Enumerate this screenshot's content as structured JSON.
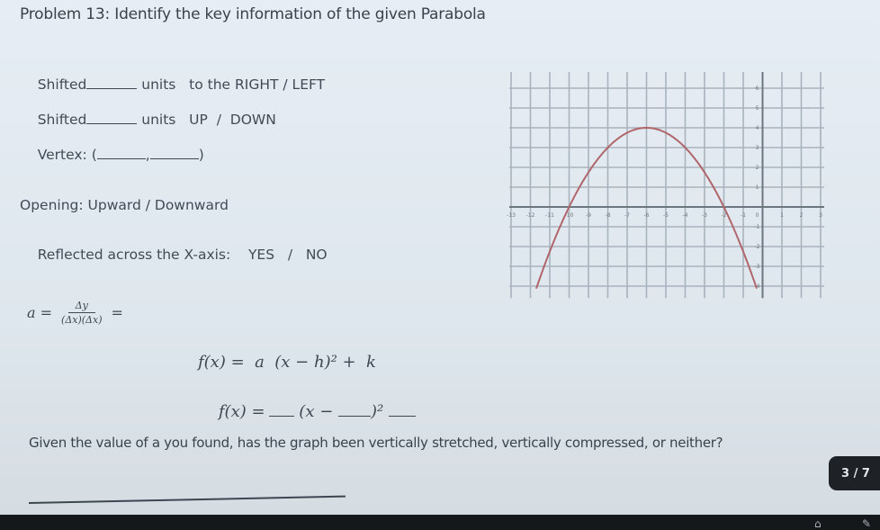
{
  "title": "Problem 13: Identify the key information of the given Parabola",
  "fields": {
    "shift_horizontal": {
      "prefix": "Shifted",
      "suffix": "units   to the RIGHT / LEFT",
      "value": ""
    },
    "shift_vertical": {
      "prefix": "Shifted",
      "suffix": "units   UP  /  DOWN",
      "value": ""
    },
    "vertex": {
      "prefix": "Vertex: (",
      "sep": ",",
      "suffix": ")",
      "h": "",
      "k": ""
    },
    "opening": "Opening: Upward / Downward",
    "reflected": {
      "label": "Reflected across the X-axis:",
      "options": "YES   /   NO"
    }
  },
  "formula_a": {
    "lhs": "a =",
    "numerator": "Δy",
    "denominator": "(Δx)(Δx)",
    "rhs": "="
  },
  "vertex_form": {
    "general": "f(x) =  a  (x − h)² +  k",
    "fill_prefix": "f(x) =",
    "fill_mid": "(x −",
    "fill_close": ")²"
  },
  "question": "Given the value of a you found, has the graph been vertically stretched, vertically compressed, or neither?",
  "answer": "",
  "page_indicator": "3 / 7",
  "chart_data": {
    "type": "line",
    "title": "",
    "xlabel": "",
    "ylabel": "",
    "xlim": [
      -13,
      3
    ],
    "ylim": [
      -4,
      6
    ],
    "xticks": [
      -13,
      -12,
      -11,
      -10,
      -9,
      -8,
      -7,
      -6,
      -5,
      -4,
      -3,
      -2,
      -1,
      0,
      1,
      2,
      3
    ],
    "yticks": [
      -4,
      -3,
      -2,
      -1,
      0,
      1,
      2,
      3,
      4,
      5,
      6
    ],
    "grid": true,
    "series": [
      {
        "name": "parabola",
        "color": "#b0666a",
        "function": "-0.25*(x+6)^2+4",
        "vertex": [
          -6,
          4
        ],
        "x_intercepts": [
          -10,
          -2
        ],
        "x_range": [
          -11.7,
          -0.3
        ]
      }
    ]
  }
}
